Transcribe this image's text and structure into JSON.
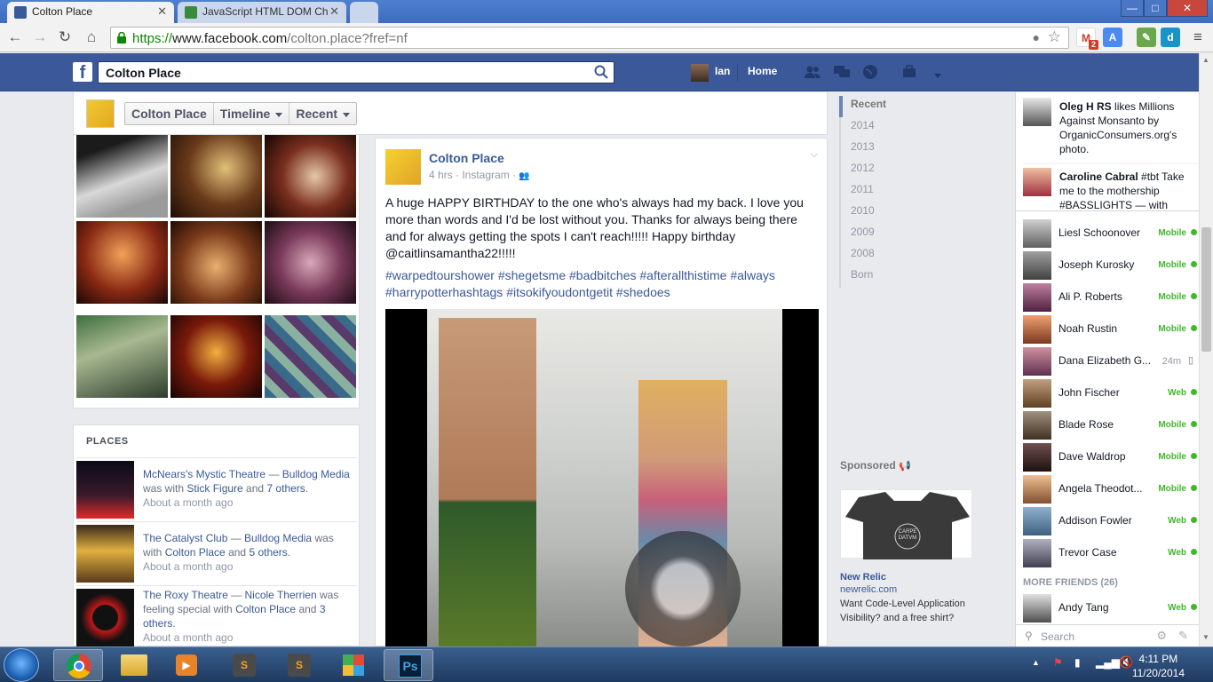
{
  "browser": {
    "tabs": [
      {
        "title": "Colton Place",
        "active": true
      },
      {
        "title": "JavaScript HTML DOM Ch",
        "active": false
      }
    ],
    "url": {
      "scheme": "https://",
      "host": "www.facebook.com",
      "path": "/colton.place?fref=nf"
    },
    "gmail_badge": "2",
    "window_buttons": {
      "minimize": "—",
      "maximize": "□",
      "close": "✕"
    }
  },
  "fb_header": {
    "logo": "f",
    "search_value": "Colton Place",
    "user_name": "Ian",
    "home_label": "Home"
  },
  "profile_bar": {
    "name_button": "Colton Place",
    "timeline_button": "Timeline",
    "recent_button": "Recent"
  },
  "places": {
    "header": "PLACES",
    "items": [
      {
        "place": "McNears's Mystic Theatre",
        "sep": " — ",
        "page": "Bulldog Media",
        "mid": " was with ",
        "person": "Stick Figure",
        "and": " and ",
        "others": "7 others",
        "end": ".",
        "time": "About a month ago"
      },
      {
        "place": "The Catalyst Club",
        "sep": " — ",
        "page": "Bulldog Media",
        "mid": " was with ",
        "person": "Colton Place",
        "and": " and ",
        "others": "5 others",
        "end": ".",
        "time": "About a month ago"
      },
      {
        "place": "The Roxy Theatre",
        "sep": " — ",
        "page": "Nicole Therrien",
        "mid": " was feeling special with ",
        "person": "Colton Place",
        "and": " and ",
        "others": "3 others",
        "end": ".",
        "time": "About a month ago"
      }
    ]
  },
  "post": {
    "author": "Colton Place",
    "meta": "4 hrs · Instagram ·",
    "text": "A huge HAPPY BIRTHDAY to the one who's always had my back. I love you more than words and I'd be lost without you. Thanks for always being there and for always getting the spots I can't reach!!!!! Happy birthday @caitlinsamantha22!!!!!",
    "hashtags": "#warpedtourshower #shegetsme #badbitches #afterallthistime #always #harrypotterhashtags #itsokifyoudontgetit #shedoes"
  },
  "years": [
    "Recent",
    "2014",
    "2013",
    "2012",
    "2011",
    "2010",
    "2009",
    "2008",
    "Born"
  ],
  "sponsored": {
    "header": "Sponsored",
    "shirt_text": "CARPE DATVM",
    "title": "New Relic",
    "site": "newrelic.com",
    "desc": "Want Code-Level Application Visibility? and a free shirt?"
  },
  "ticker": [
    {
      "name": "Oleg H RS",
      "text": " likes Millions Against Monsanto by OrganicConsumers.org's photo."
    },
    {
      "name": "Caroline Cabral",
      "text": " #tbt Take me to the mothership #BASSLIGHTS — with"
    }
  ],
  "friends": [
    {
      "name": "Liesl Schoonover",
      "status": "Mobile"
    },
    {
      "name": "Joseph Kurosky",
      "status": "Mobile"
    },
    {
      "name": "Ali P. Roberts",
      "status": "Mobile"
    },
    {
      "name": "Noah Rustin",
      "status": "Mobile"
    },
    {
      "name": "Dana Elizabeth G...",
      "status": "24m"
    },
    {
      "name": "John Fischer",
      "status": "Web"
    },
    {
      "name": "Blade Rose",
      "status": "Mobile"
    },
    {
      "name": "Dave Waldrop",
      "status": "Mobile"
    },
    {
      "name": "Angela Theodot...",
      "status": "Mobile"
    },
    {
      "name": "Addison Fowler",
      "status": "Web"
    },
    {
      "name": "Trevor Case",
      "status": "Web"
    }
  ],
  "more_friends": "MORE FRIENDS (26)",
  "more_friends_list": [
    {
      "name": "Andy Tang",
      "status": "Web"
    }
  ],
  "chat_search_placeholder": "Search",
  "clock": {
    "time": "4:11 PM",
    "date": "11/20/2014"
  },
  "colors": {
    "fb_blue": "#3b5998",
    "online_green": "#42b72a",
    "link": "#3b5998"
  }
}
